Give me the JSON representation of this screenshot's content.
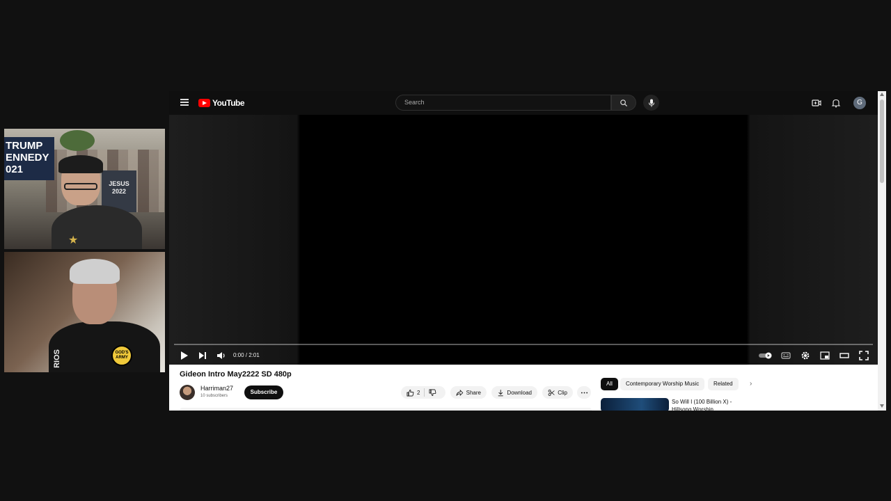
{
  "cam_top": {
    "sign_text": "TRUMP\nENNEDY\n021",
    "shirt_text": "JESUS\n2022"
  },
  "cam_bottom": {
    "badge_text": "GOD'S ARMY",
    "sleeve_text": "RIOS"
  },
  "header": {
    "logo_text": "YouTube",
    "search_placeholder": "Search",
    "avatar_letter": "G"
  },
  "player": {
    "time": "0:00 / 2:01",
    "progress_fraction": 0
  },
  "video": {
    "title": "Gideon Intro May2222 SD 480p",
    "channel_name": "Harriman27",
    "subscribers": "10 subscribers",
    "subscribe_label": "Subscribe",
    "like_count": "2",
    "share_label": "Share",
    "download_label": "Download",
    "clip_label": "Clip"
  },
  "chips": {
    "all": "All",
    "cwm": "Contemporary Worship Music",
    "related": "Related"
  },
  "recommendation": {
    "title": "So Will I (100 Billion X) - Hillsong Worship"
  },
  "colors": {
    "brand_red": "#ff0000",
    "dark_bg": "#0f0f0f"
  }
}
